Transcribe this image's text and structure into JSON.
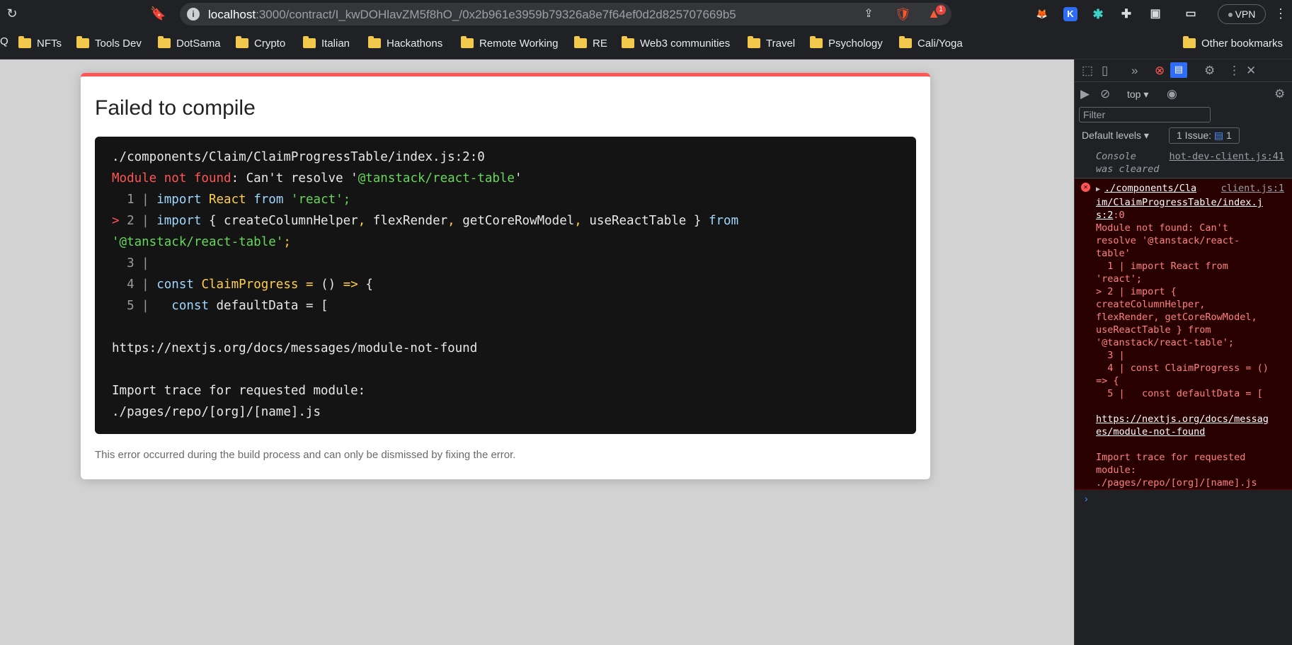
{
  "browser": {
    "url_host": "localhost",
    "url_rest": ":3000/contract/I_kwDOHlavZM5f8hO_/0x2b961e3959b79326a8e7f64ef0d2d825707669b5",
    "notification_count": "1",
    "vpn_label": "VPN"
  },
  "bookmarks": {
    "items": [
      "NFTs",
      "Tools Dev",
      "DotSama",
      "Crypto",
      "Italian",
      "Hackathons",
      "Remote Working",
      "RE",
      "Web3 communities",
      "Travel",
      "Psychology",
      "Cali/Yoga"
    ],
    "other": "Other bookmarks"
  },
  "overlay": {
    "title": "Failed to compile",
    "file_line": "./components/Claim/ClaimProgressTable/index.js:2:0",
    "err_label": "Module not found",
    "err_text": ": Can't resolve '",
    "err_module": "@tanstack/react-table",
    "err_quote": "'",
    "l1_num": "  1 | ",
    "l1_import": "import",
    "l1_react": "React",
    "l1_from": "from",
    "l1_str": "'react';",
    "l2_marker": ">",
    "l2_num": " 2 | ",
    "l2_import": "import",
    "l2_body1": " { createColumnHelper",
    "l2_comma1": ",",
    "l2_body2": " flexRender",
    "l2_comma2": ",",
    "l2_body3": " getCoreRowModel",
    "l2_comma3": ",",
    "l2_body4": " useReactTable } ",
    "l2_from": "from",
    "l2_cont_str": "'@tanstack/react-table'",
    "l2_cont_semi": ";",
    "l3": "  3 |",
    "l4_num": "  4 | ",
    "l4_const": "const",
    "l4_name": "ClaimProgress",
    "l4_eq": "=",
    "l4_paren": "()",
    "l4_arrow": "=>",
    "l4_brace": "{",
    "l5_num": "  5 |   ",
    "l5_const": "const",
    "l5_rest": " defaultData = [",
    "doc_link": "https://nextjs.org/docs/messages/module-not-found",
    "trace_title": "Import trace for requested module:",
    "trace_file": "./pages/repo/[org]/[name].js",
    "footer": "This error occurred during the build process and can only be dismissed by fixing the error."
  },
  "devtools": {
    "context": "top",
    "filter_placeholder": "Filter",
    "levels": "Default levels",
    "issues": "1 Issue:",
    "issues_count": "1",
    "cleared_text": "Console\nwas cleared",
    "cleared_src": "hot-dev-client.js:41",
    "error_src": "client.js:1",
    "error_link_1": "./components/Cla",
    "error_link_2": "im/ClaimProgressTable/index.j",
    "error_link_3": "s:2",
    "error_pos": ":0",
    "error_body": "Module not found: Can't\nresolve '@tanstack/react-\ntable'\n  1 | import React from\n'react';\n> 2 | import {\ncreateColumnHelper,\nflexRender, getCoreRowModel,\nuseReactTable } from\n'@tanstack/react-table';\n  3 |\n  4 | const ClaimProgress = ()\n=> {\n  5 |   const defaultData = [",
    "error_doc_1": "https://nextjs.org/docs/messag",
    "error_doc_2": "es/module-not-found",
    "error_trace": "Import trace for requested\nmodule:\n./pages/repo/[org]/[name].js"
  }
}
